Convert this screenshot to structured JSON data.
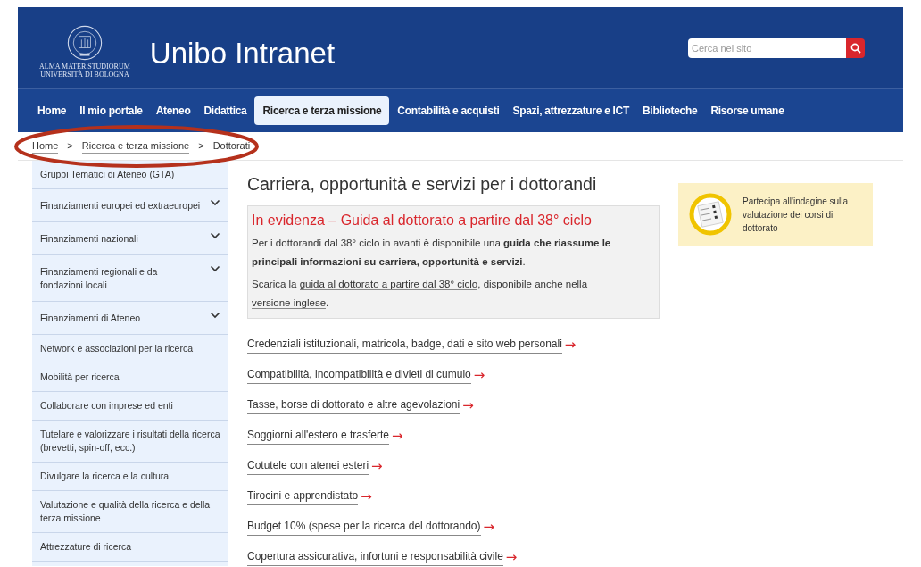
{
  "header": {
    "logo_lines": [
      "ALMA MATER STUDIORUM",
      "UNIVERSITÀ DI BOLOGNA"
    ],
    "title": "Unibo Intranet",
    "search": {
      "placeholder": "Cerca nel sito"
    }
  },
  "nav": [
    {
      "label": "Home",
      "selected": false
    },
    {
      "label": "Il mio portale",
      "selected": false
    },
    {
      "label": "Ateneo",
      "selected": false
    },
    {
      "label": "Didattica",
      "selected": false
    },
    {
      "label": "Ricerca e terza missione",
      "selected": true
    },
    {
      "label": "Contabilità e acquisti",
      "selected": false
    },
    {
      "label": "Spazi, attrezzature e ICT",
      "selected": false
    },
    {
      "label": "Biblioteche",
      "selected": false
    },
    {
      "label": "Risorse umane",
      "selected": false
    }
  ],
  "breadcrumb": [
    {
      "label": "Home",
      "kind": "link"
    },
    {
      "label": "Ricerca e terza missione",
      "kind": "link"
    },
    {
      "label": "Dottorati",
      "kind": "current"
    }
  ],
  "breadcrumb_separator": ">",
  "sidebar": [
    {
      "label": "Gruppi Tematici di Ateneo (GTA)",
      "kind": "link"
    },
    {
      "label": "Finanziamenti europei ed extraeuropei",
      "kind": "submenu"
    },
    {
      "label": "Finanziamenti nazionali",
      "kind": "submenu"
    },
    {
      "label": "Finanziamenti regionali e da fondazioni locali",
      "kind": "submenu"
    },
    {
      "label": "Finanziamenti di Ateneo",
      "kind": "submenu"
    },
    {
      "label": "Network e associazioni per la ricerca",
      "kind": "link"
    },
    {
      "label": "Mobilità per ricerca",
      "kind": "link"
    },
    {
      "label": "Collaborare con imprese ed enti",
      "kind": "link"
    },
    {
      "label": "Tutelare e valorizzare i risultati della ricerca (brevetti, spin-off, ecc.)",
      "kind": "link"
    },
    {
      "label": "Divulgare la ricerca e la cultura",
      "kind": "link"
    },
    {
      "label": "Valutazione e qualità della ricerca e della terza missione",
      "kind": "link"
    },
    {
      "label": "Attrezzature di ricerca",
      "kind": "link"
    }
  ],
  "main": {
    "title": "Carriera, opportunità e servizi per i dottorandi",
    "highlight": {
      "title": "In evidenza – Guida al dottorato a partire dal 38° ciclo",
      "paragraph_1": "Per i dottorandi dal 38° ciclo in avanti è disponibile una **guida che riassume le principali informazioni su carriera, opportunità e servizi**.",
      "paragraph_2": [
        {
          "kind": "text",
          "text": "Scarica la"
        },
        {
          "kind": "link",
          "text": "guida al dottorato a partire dal 38° ciclo"
        },
        {
          "kind": "text",
          "text": ", disponibile anche nella"
        },
        {
          "kind": "link",
          "text": "versione inglese"
        },
        {
          "kind": "text",
          "text": "."
        }
      ]
    },
    "links": [
      "Credenziali istituzionali, matricola, badge, dati e sito web personali",
      "Compatibilità, incompatibilità e divieti di cumulo",
      "Tasse, borse di dottorato e altre agevolazioni",
      "Soggiorni all'estero e trasferte",
      "Cotutele con atenei esteri",
      "Tirocini e apprendistato",
      "Budget 10% (spese per la ricerca del dottorando)",
      "Copertura assicurativa, infortuni e responsabilità civile"
    ],
    "link_arrow": "→"
  },
  "survey_card": {
    "text": "Partecipa all'indagine sulla valutazione dei corsi di dottorato"
  }
}
